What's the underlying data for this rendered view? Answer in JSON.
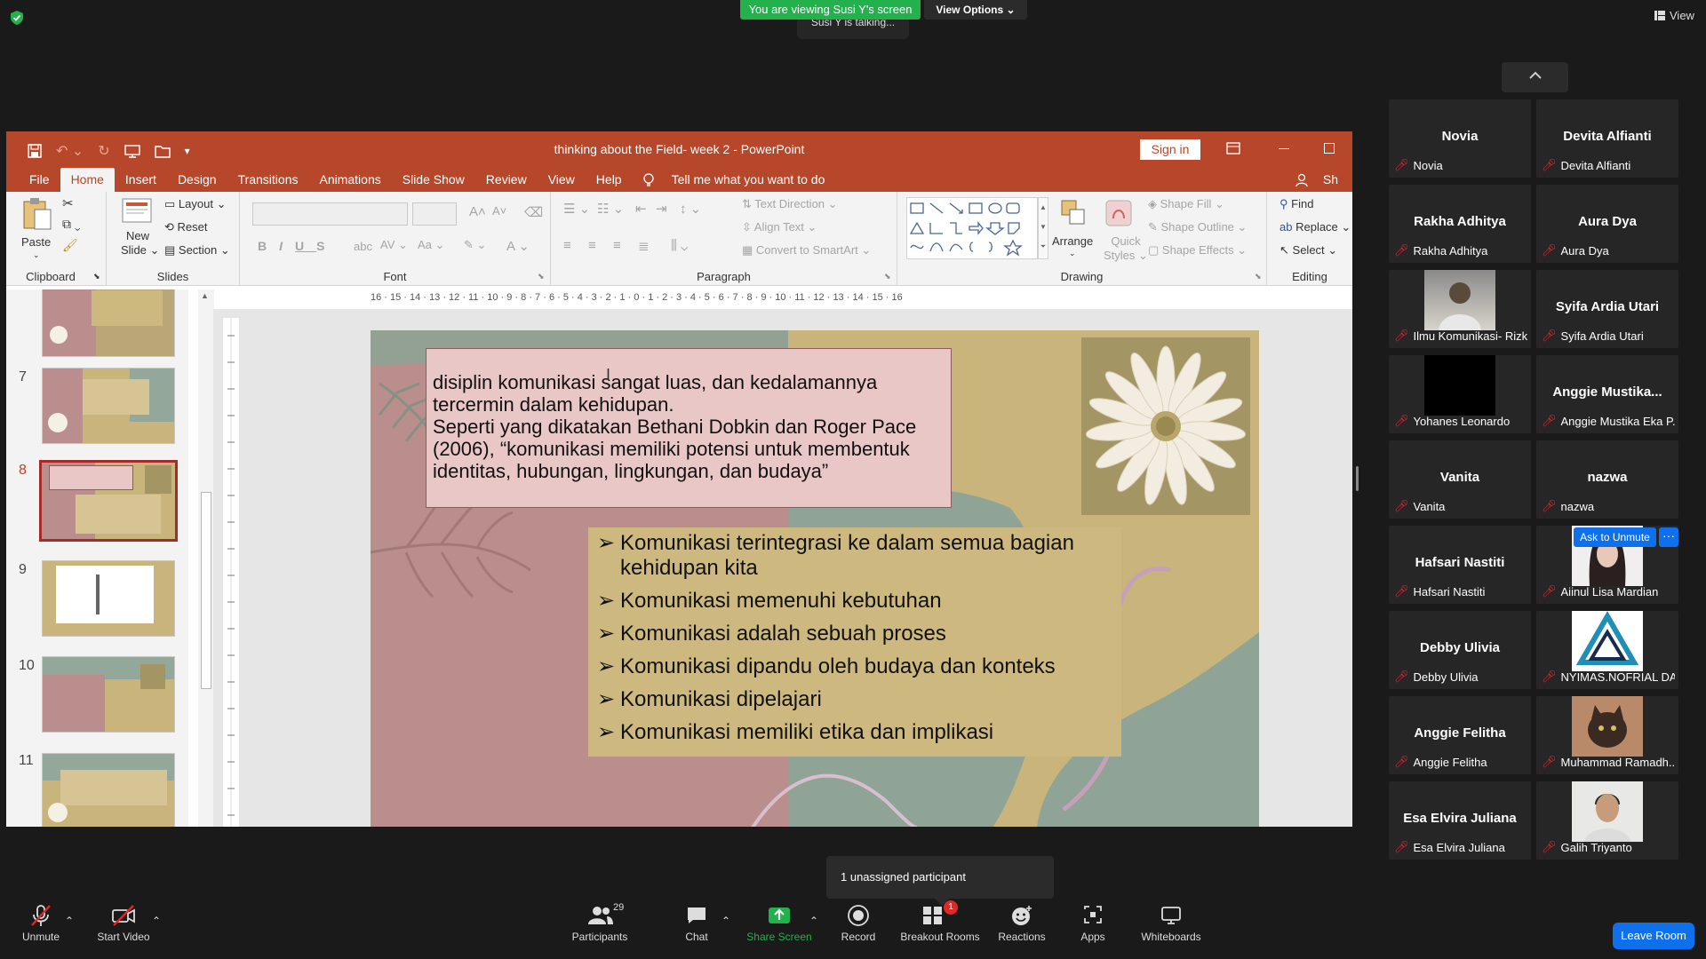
{
  "zoom": {
    "viewing_banner": "You are viewing Susi Y's screen",
    "view_options": "View Options",
    "talking": "Susi Y is talking...",
    "view_button": "View",
    "tooltip": "1 unassigned participant",
    "leave": "Leave Room",
    "toolbar": {
      "unmute": "Unmute",
      "start_video": "Start Video",
      "participants": "Participants",
      "participants_count": "29",
      "chat": "Chat",
      "share_screen": "Share Screen",
      "record": "Record",
      "breakout_rooms": "Breakout Rooms",
      "breakout_badge": "1",
      "reactions": "Reactions",
      "apps": "Apps",
      "whiteboards": "Whiteboards"
    },
    "ask_to_unmute": "Ask to Unmute",
    "ask_more": "···",
    "participants": [
      {
        "big": "Novia",
        "small": "Novia"
      },
      {
        "big": "Devita Alfianti",
        "small": "Devita Alfianti"
      },
      {
        "big": "Rakha Adhitya",
        "small": "Rakha Adhitya"
      },
      {
        "big": "Aura Dya",
        "small": "Aura Dya"
      },
      {
        "big": "",
        "small": "Ilmu Komunikasi- Rizk..."
      },
      {
        "big": "Syifa Ardia Utari",
        "small": "Syifa Ardia Utari"
      },
      {
        "big": "",
        "small": "Yohanes Leonardo"
      },
      {
        "big": "Anggie  Mustika...",
        "small": "Anggie Mustika Eka P..."
      },
      {
        "big": "Vanita",
        "small": "Vanita"
      },
      {
        "big": "nazwa",
        "small": "nazwa"
      },
      {
        "big": "Hafsari Nastiti",
        "small": "Hafsari Nastiti"
      },
      {
        "big": "",
        "small": "Aiinul Lisa Mardian"
      },
      {
        "big": "Debby Ulivia",
        "small": "Debby Ulivia"
      },
      {
        "big": "",
        "small": "NYIMAS.NOFRIAL DA..."
      },
      {
        "big": "Anggie Felitha",
        "small": "Anggie Felitha"
      },
      {
        "big": "",
        "small": "Muhammad Ramadh..."
      },
      {
        "big": "Esa Elvira Juliana",
        "small": "Esa Elvira Juliana"
      },
      {
        "big": "",
        "small": "Galih Triyanto"
      }
    ]
  },
  "ppt": {
    "title": "thinking about the Field- week 2  -  PowerPoint",
    "sign_in": "Sign in",
    "menu": [
      "File",
      "Home",
      "Insert",
      "Design",
      "Transitions",
      "Animations",
      "Slide Show",
      "Review",
      "View",
      "Help"
    ],
    "tell_me": "Tell me what you want to do",
    "share_partial": "Sh",
    "ribbon": {
      "paste": "Paste",
      "new_slide": "New",
      "new_slide2": "Slide",
      "layout": "Layout",
      "reset": "Reset",
      "section": "Section",
      "text_direction": "Text Direction",
      "align_text": "Align Text",
      "convert_smartart": "Convert to SmartArt",
      "arrange": "Arrange",
      "quick_styles": "Quick",
      "quick_styles2": "Styles",
      "shape_fill": "Shape Fill",
      "shape_outline": "Shape Outline",
      "shape_effects": "Shape Effects",
      "find": "Find",
      "replace": "Replace",
      "select": "Select",
      "groups": {
        "clipboard": "Clipboard",
        "slides": "Slides",
        "font": "Font",
        "paragraph": "Paragraph",
        "drawing": "Drawing",
        "editing": "Editing"
      }
    },
    "slide_numbers": [
      "7",
      "8",
      "9",
      "10",
      "11"
    ],
    "current_slide": "8",
    "ruler_labels": "16 · 15 · 14 · 13 · 12 · 11 · 10 · 9 · 8 · 7 · 6 · 5 · 4 · 3 · 2 · 1 · 0 · 1 · 2 · 3 · 4 · 5 · 6 · 7 · 8 · 9 · 10 · 11 · 12 · 13 · 14 · 15 · 16",
    "slide": {
      "top_text": [
        "disiplin komunikasi sangat luas, dan kedalamannya",
        "tercermin dalam kehidupan.",
        "Seperti yang dikatakan Bethani Dobkin dan Roger Pace",
        "(2006), “komunikasi memiliki potensi untuk membentuk",
        "identitas, hubungan, lingkungan, dan budaya”"
      ],
      "bullets": [
        "Komunikasi terintegrasi ke dalam semua bagian kehidupan kita",
        "Komunikasi memenuhi kebutuhan",
        "Komunikasi adalah sebuah proses",
        "Komunikasi dipandu oleh budaya dan konteks",
        "Komunikasi dipelajari",
        "Komunikasi memiliki etika dan implikasi"
      ]
    }
  },
  "colors": {
    "ppt_red": "#b7472a",
    "zoom_green": "#22b14c",
    "zoom_blue": "#0e71eb",
    "mute_red": "#e02828"
  }
}
